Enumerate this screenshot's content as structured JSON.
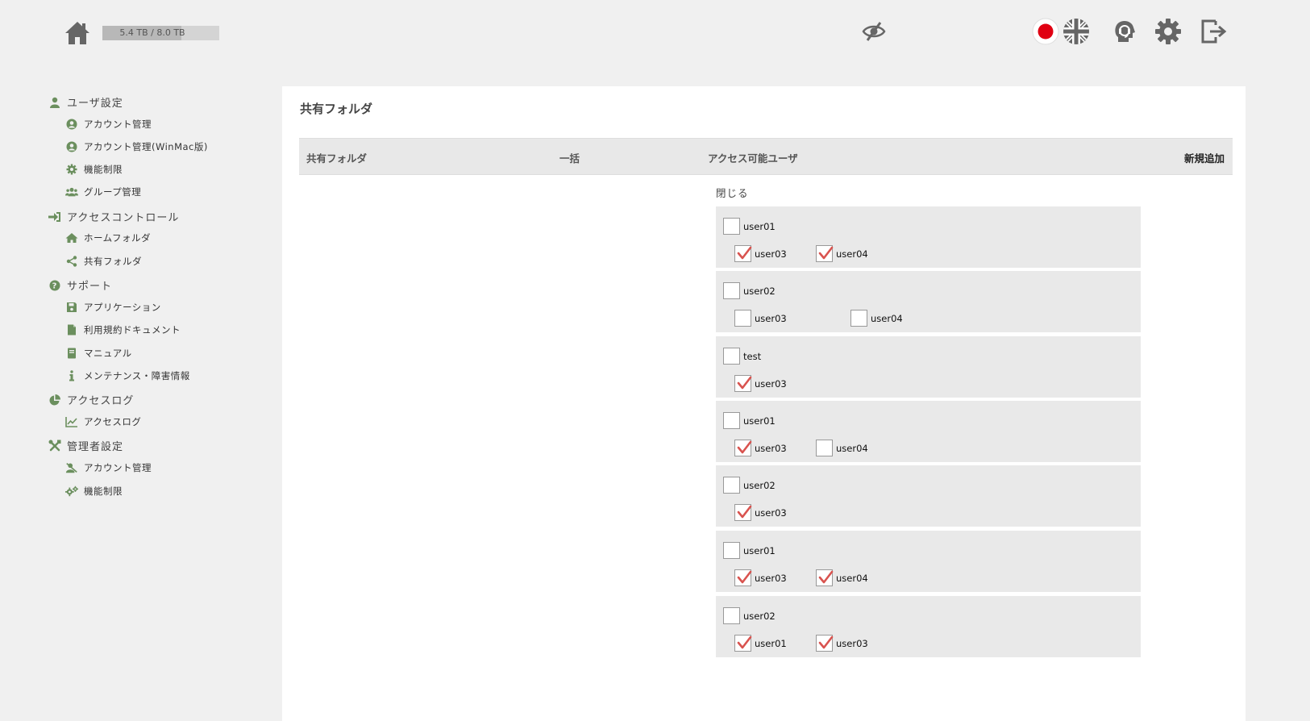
{
  "header": {
    "storage_text": "5.4 TB / 8.0 TB",
    "storage_used_fraction": 0.675,
    "icons": [
      "home-icon",
      "hidden-eye-icon",
      "japan-flag-icon",
      "uk-flag-icon",
      "support-icon",
      "settings-gear-icon",
      "logout-icon"
    ]
  },
  "sidebar": {
    "sections": [
      {
        "label": "ユーザ設定",
        "icon": "user-icon",
        "items": [
          {
            "label": "アカウント管理",
            "icon": "account-circle-icon"
          },
          {
            "label": "アカウント管理(WinMac版)",
            "icon": "account-circle-icon"
          },
          {
            "label": "機能制限",
            "icon": "gear-icon"
          },
          {
            "label": "グループ管理",
            "icon": "group-icon"
          }
        ]
      },
      {
        "label": "アクセスコントロール",
        "icon": "sign-in-icon",
        "items": [
          {
            "label": "ホームフォルダ",
            "icon": "home-icon"
          },
          {
            "label": "共有フォルダ",
            "icon": "share-icon"
          }
        ]
      },
      {
        "label": "サポート",
        "icon": "question-icon",
        "items": [
          {
            "label": "アプリケーション",
            "icon": "save-icon"
          },
          {
            "label": "利用規約ドキュメント",
            "icon": "document-icon"
          },
          {
            "label": "マニュアル",
            "icon": "book-icon"
          },
          {
            "label": "メンテナンス・障害情報",
            "icon": "info-icon"
          }
        ]
      },
      {
        "label": "アクセスログ",
        "icon": "pie-chart-icon",
        "items": [
          {
            "label": "アクセスログ",
            "icon": "line-chart-icon"
          }
        ]
      },
      {
        "label": "管理者設定",
        "icon": "tools-icon",
        "items": [
          {
            "label": "アカウント管理",
            "icon": "user-admin-icon"
          },
          {
            "label": "機能制限",
            "icon": "gears-icon"
          }
        ]
      }
    ]
  },
  "main": {
    "title": "共有フォルダ",
    "columns": {
      "folder": "共有フォルダ",
      "bulk": "一括",
      "users": "アクセス可能ユーザ",
      "add_new": "新規追加"
    },
    "close_label": "閉じる",
    "groups": [
      {
        "name": "user01",
        "checked": false,
        "children": [
          {
            "name": "user03",
            "checked": true
          },
          {
            "name": "user04",
            "checked": true
          }
        ]
      },
      {
        "name": "user02",
        "checked": false,
        "children": [
          {
            "name": "user03",
            "checked": false
          },
          {
            "name": "user04",
            "checked": false
          }
        ]
      },
      {
        "name": "test",
        "checked": false,
        "children": [
          {
            "name": "user03",
            "checked": true
          }
        ]
      },
      {
        "name": "user01",
        "checked": false,
        "children": [
          {
            "name": "user03",
            "checked": true
          },
          {
            "name": "user04",
            "checked": false
          }
        ]
      },
      {
        "name": "user02",
        "checked": false,
        "children": [
          {
            "name": "user03",
            "checked": true
          }
        ]
      },
      {
        "name": "user01",
        "checked": false,
        "children": [
          {
            "name": "user03",
            "checked": true
          },
          {
            "name": "user04",
            "checked": true
          }
        ]
      },
      {
        "name": "user02",
        "checked": false,
        "children": [
          {
            "name": "user01",
            "checked": true
          },
          {
            "name": "user03",
            "checked": true
          }
        ]
      }
    ]
  },
  "colors": {
    "sidebar_icon": "#6b8f5e",
    "check": "#d9534f",
    "panel_bg": "#ffffff",
    "page_bg": "#f0f0f0",
    "group_bg": "#e9e9e9",
    "header_icon": "#666666"
  }
}
